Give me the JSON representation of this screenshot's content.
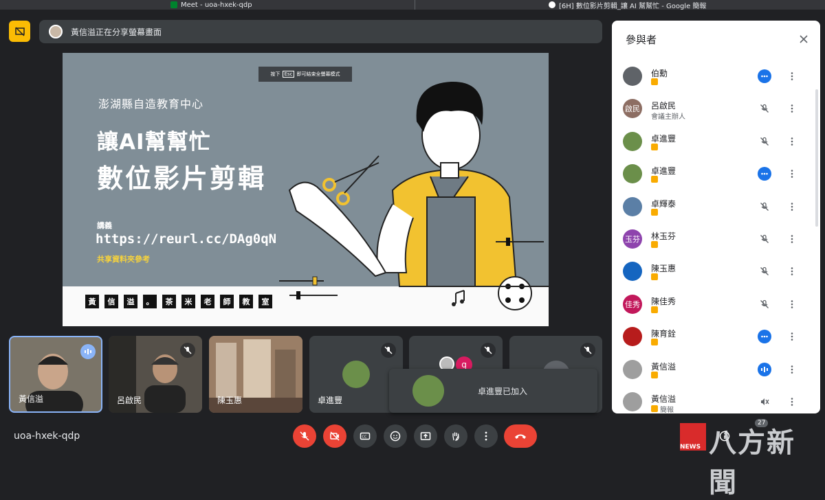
{
  "tabs": [
    {
      "title": "Meet - uoa-hxek-qdp"
    },
    {
      "title": "[6H] 數位影片剪輯_讓 AI 幫幫忙 - Google 簡報"
    }
  ],
  "banner": {
    "text": "黃信溢正在分享螢幕畫面"
  },
  "slide": {
    "esc_hint_pre": "按下",
    "esc_key": "Esc",
    "esc_hint_post": "即可結束全螢幕模式",
    "org": "澎湖縣自造教育中心",
    "title_line1": "讓AI幫幫忙",
    "title_line2": "數位影片剪輯",
    "lecture_label": "講義",
    "url": "https://reurl.cc/DAg0qN",
    "shared_note": "共享資料夾參考",
    "signature_chars": [
      "黃",
      "信",
      "溢",
      "。",
      "茶",
      "米",
      "老",
      "師",
      "教",
      "室"
    ]
  },
  "tiles": [
    {
      "name": "黃信溢",
      "state": "speaking"
    },
    {
      "name": "呂啟民",
      "state": "muted"
    },
    {
      "name": "陳玉惠",
      "state": "none"
    },
    {
      "name": "卓進豐",
      "state": "muted"
    },
    {
      "name": "",
      "state": "muted",
      "avatar_letter": "q"
    },
    {
      "name": "",
      "state": "muted"
    }
  ],
  "toast": {
    "text": "卓進豐已加入"
  },
  "meeting_code": "uoa-hxek-qdp",
  "participants_count": "27",
  "panel": {
    "title": "參與者",
    "participants": [
      {
        "name": "伯勳",
        "sub": "",
        "avatar": "",
        "avatar_color": "#5f6368",
        "state": "more"
      },
      {
        "name": "呂啟民",
        "sub": "會議主辦人",
        "avatar": "啟民",
        "avatar_color": "#8d6e63",
        "state": "muted"
      },
      {
        "name": "卓進豐",
        "sub": "",
        "avatar": "",
        "avatar_color": "#6b8f4a",
        "state": "muted"
      },
      {
        "name": "卓進豐",
        "sub": "",
        "avatar": "",
        "avatar_color": "#6b8f4a",
        "state": "more"
      },
      {
        "name": "卓輝泰",
        "sub": "",
        "avatar": "",
        "avatar_color": "#5b7fa6",
        "state": "muted"
      },
      {
        "name": "林玉芬",
        "sub": "",
        "avatar": "玉芬",
        "avatar_color": "#8e44ad",
        "state": "muted"
      },
      {
        "name": "陳玉惠",
        "sub": "",
        "avatar": "",
        "avatar_color": "#1565c0",
        "state": "muted"
      },
      {
        "name": "陳佳秀",
        "sub": "",
        "avatar": "佳秀",
        "avatar_color": "#c2185b",
        "state": "muted"
      },
      {
        "name": "陳育銓",
        "sub": "",
        "avatar": "",
        "avatar_color": "#b71c1c",
        "state": "more"
      },
      {
        "name": "黃信溢",
        "sub": "",
        "avatar": "",
        "avatar_color": "#9e9e9e",
        "state": "speaking"
      },
      {
        "name": "黃信溢",
        "sub": "簡報",
        "avatar": "",
        "avatar_color": "#9e9e9e",
        "state": "presenting"
      }
    ]
  },
  "watermark": {
    "news_label": "NEWS",
    "text": "八方新聞"
  },
  "colors": {
    "accent": "#8ab4f8",
    "present": "#fbbc04",
    "danger": "#ea4335",
    "badge": "#f9ab00"
  }
}
